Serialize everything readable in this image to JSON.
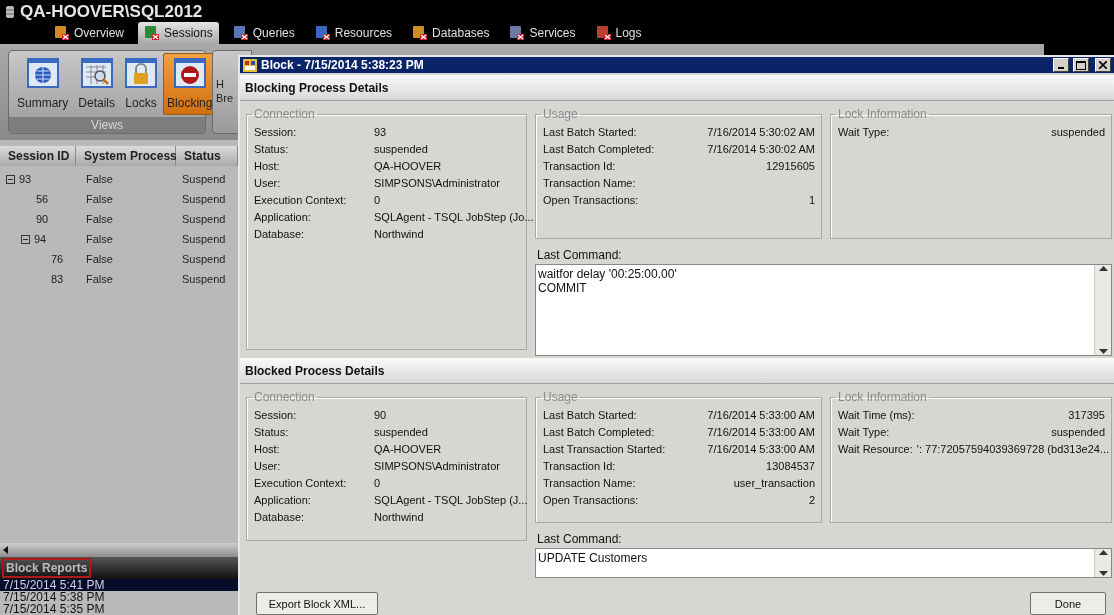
{
  "app": {
    "title": "QA-HOOVER\\SQL2012",
    "tabs": [
      {
        "label": "Overview",
        "selected": false
      },
      {
        "label": "Sessions",
        "selected": true
      },
      {
        "label": "Queries",
        "selected": false
      },
      {
        "label": "Resources",
        "selected": false
      },
      {
        "label": "Databases",
        "selected": false
      },
      {
        "label": "Services",
        "selected": false
      },
      {
        "label": "Logs",
        "selected": false
      }
    ],
    "ribbon": {
      "group_label": "Views",
      "buttons": [
        {
          "label": "Summary",
          "kind": "globe",
          "selected": false
        },
        {
          "label": "Details",
          "kind": "grid",
          "selected": false
        },
        {
          "label": "Locks",
          "kind": "lock",
          "selected": false
        },
        {
          "label": "Blocking",
          "kind": "stop",
          "selected": true
        }
      ],
      "partial_button": {
        "lines": [
          "H",
          "Bre"
        ]
      }
    },
    "table": {
      "columns": [
        "Session ID",
        "System Process",
        "Status"
      ],
      "rows": [
        {
          "session_id": "93",
          "system_process": "False",
          "status": "Suspend",
          "expanded": true,
          "children": [
            {
              "session_id": "56",
              "system_process": "False",
              "status": "Suspend"
            },
            {
              "session_id": "90",
              "system_process": "False",
              "status": "Suspend"
            },
            {
              "session_id": "94",
              "system_process": "False",
              "status": "Suspend",
              "expanded": true,
              "children": [
                {
                  "session_id": "76",
                  "system_process": "False",
                  "status": "Suspend"
                },
                {
                  "session_id": "83",
                  "system_process": "False",
                  "status": "Suspend"
                }
              ]
            }
          ]
        }
      ]
    },
    "block_reports": {
      "title": "Block Reports",
      "items": [
        {
          "label": "7/15/2014 5:41 PM",
          "selected": true
        },
        {
          "label": "7/15/2014 5:38 PM",
          "selected": false
        },
        {
          "label": "7/15/2014 5:35 PM",
          "selected": false
        }
      ]
    }
  },
  "dialog": {
    "title": "Block - 7/15/2014 5:38:23 PM",
    "sections": [
      {
        "heading": "Blocking Process Details",
        "groups": [
          {
            "kind": "connection",
            "title": "Connection",
            "fields": [
              {
                "label": "Session:",
                "value": "93"
              },
              {
                "label": "Status:",
                "value": "suspended"
              },
              {
                "label": "Host:",
                "value": "QA-HOOVER"
              },
              {
                "label": "User:",
                "value": "SIMPSONS\\Administrator"
              },
              {
                "label": "Execution Context:",
                "value": "0"
              },
              {
                "label": "Application:",
                "value": "SQLAgent - TSQL JobStep (Jo..."
              },
              {
                "label": "Database:",
                "value": "Northwind"
              }
            ]
          },
          {
            "kind": "usage",
            "title": "Usage",
            "fields": [
              {
                "label": "Last Batch Started:",
                "value": "7/16/2014 5:30:02 AM"
              },
              {
                "label": "Last Batch Completed:",
                "value": "7/16/2014 5:30:02 AM"
              },
              {
                "label": "Transaction Id:",
                "value": "12915605"
              },
              {
                "label": "Transaction Name:"
              },
              {
                "label": "Open Transactions:",
                "value": "1"
              }
            ]
          },
          {
            "kind": "lock",
            "title": "Lock Information",
            "fields": [
              {
                "label": "Wait Type:",
                "value": "suspended"
              }
            ]
          }
        ],
        "last_command": {
          "label": "Last Command:",
          "value": "waitfor delay '00:25:00.00'\nCOMMIT"
        }
      },
      {
        "heading": "Blocked Process Details",
        "groups": [
          {
            "kind": "connection",
            "title": "Connection",
            "fields": [
              {
                "label": "Session:",
                "value": "90"
              },
              {
                "label": "Status:",
                "value": "suspended"
              },
              {
                "label": "Host:",
                "value": "QA-HOOVER"
              },
              {
                "label": "User:",
                "value": "SIMPSONS\\Administrator"
              },
              {
                "label": "Execution Context:",
                "value": "0"
              },
              {
                "label": "Application:",
                "value": "SQLAgent - TSQL JobStep (J..."
              },
              {
                "label": "Database:",
                "value": "Northwind"
              }
            ]
          },
          {
            "kind": "usage",
            "title": "Usage",
            "fields": [
              {
                "label": "Last Batch Started:",
                "value": "7/16/2014 5:33:00 AM"
              },
              {
                "label": "Last Batch Completed:",
                "value": "7/16/2014 5:33:00 AM"
              },
              {
                "label": "Last Transaction Started:",
                "value": "7/16/2014 5:33:00 AM"
              },
              {
                "label": "Transaction Id:",
                "value": "13084537"
              },
              {
                "label": "Transaction Name:",
                "value": "user_transaction"
              },
              {
                "label": "Open Transactions:",
                "value": "2"
              }
            ]
          },
          {
            "kind": "lock",
            "title": "Lock Information",
            "fields": [
              {
                "label": "Wait Time (ms):",
                "value": "317395"
              },
              {
                "label": "Wait Type:",
                "value": "suspended"
              },
              {
                "label": "Wait Resource:",
                "value": "': 77:72057594039369728 (bd313e24..."
              }
            ]
          }
        ],
        "last_command": {
          "label": "Last Command:",
          "value": "UPDATE Customers"
        }
      }
    ],
    "buttons": [
      {
        "label": "Export Block XML...",
        "kind": "left"
      },
      {
        "label": "Done",
        "kind": "right"
      }
    ]
  }
}
